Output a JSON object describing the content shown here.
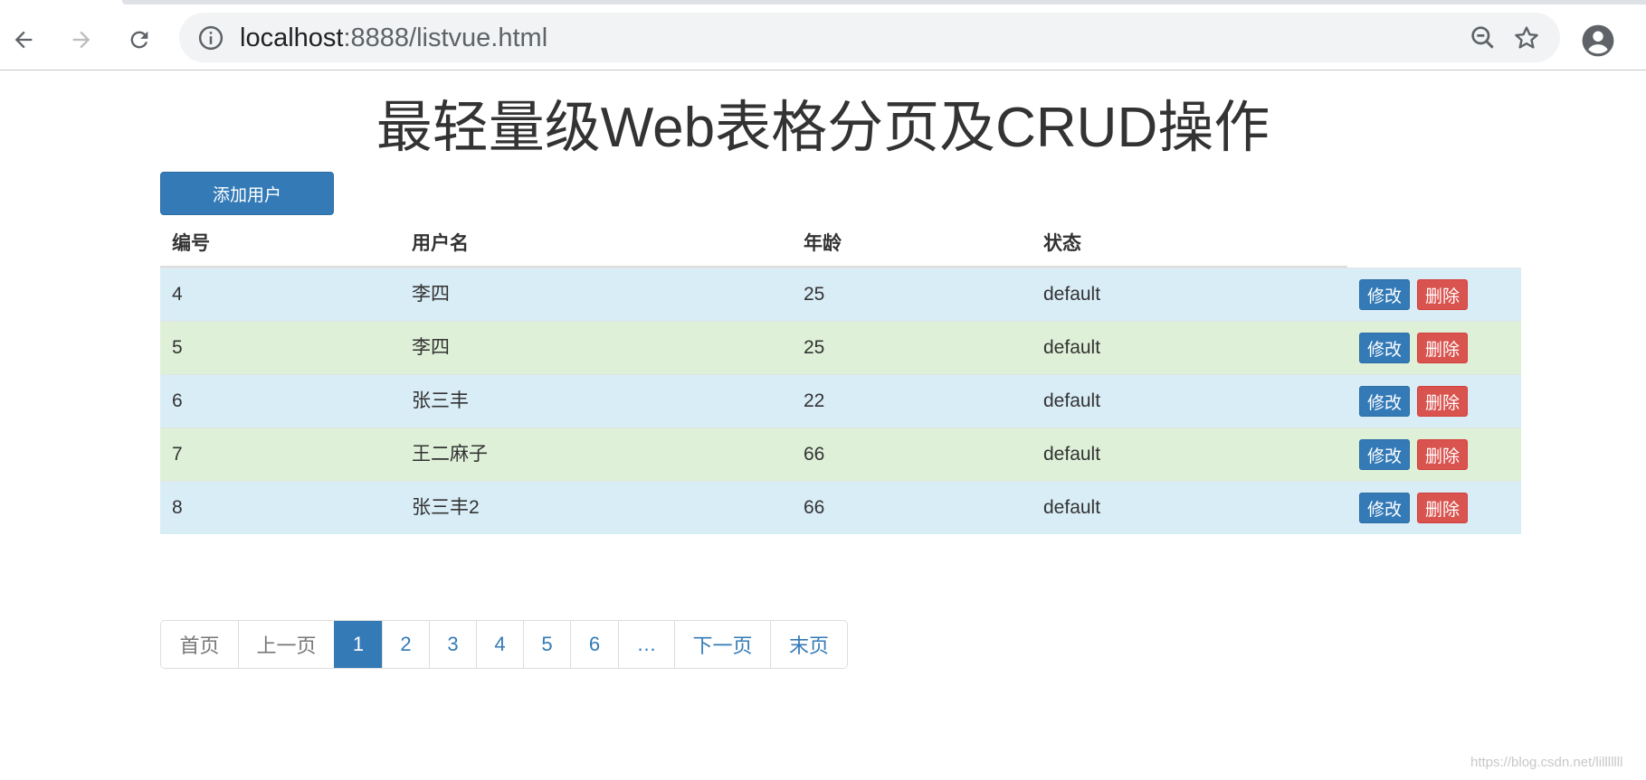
{
  "browser": {
    "url_host": "localhost",
    "url_rest": ":8888/listvue.html",
    "icons": [
      "back-arrow-icon",
      "forward-arrow-icon",
      "reload-icon",
      "info-icon",
      "zoom-out-icon",
      "star-icon",
      "account-icon"
    ]
  },
  "page": {
    "title": "最轻量级Web表格分页及CRUD操作",
    "add_button": "添加用户"
  },
  "table": {
    "headers": [
      "编号",
      "用户名",
      "年龄",
      "状态"
    ],
    "edit_label": "修改",
    "delete_label": "删除",
    "rows": [
      {
        "id": "4",
        "name": "李四",
        "age": "25",
        "status": "default"
      },
      {
        "id": "5",
        "name": "李四",
        "age": "25",
        "status": "default"
      },
      {
        "id": "6",
        "name": "张三丰",
        "age": "22",
        "status": "default"
      },
      {
        "id": "7",
        "name": "王二麻子",
        "age": "66",
        "status": "default"
      },
      {
        "id": "8",
        "name": "张三丰2",
        "age": "66",
        "status": "default"
      }
    ]
  },
  "pagination": {
    "first": "首页",
    "prev": "上一页",
    "pages": [
      "1",
      "2",
      "3",
      "4",
      "5",
      "6"
    ],
    "active_page": "1",
    "ellipsis": "…",
    "next": "下一页",
    "last": "末页"
  },
  "watermark": "https://blog.csdn.net/lilllllll",
  "colors": {
    "primary": "#337ab7",
    "danger": "#d9534f",
    "row_info": "#d9edf7",
    "row_success": "#dff0d8"
  }
}
